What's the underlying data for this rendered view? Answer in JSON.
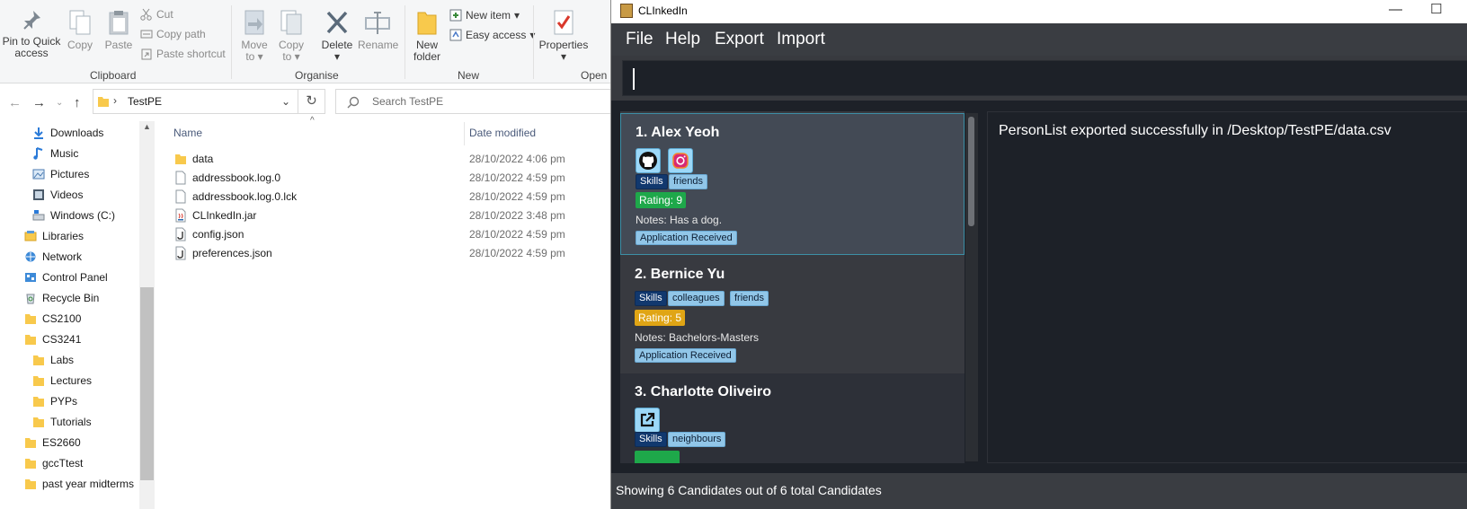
{
  "explorer": {
    "ribbon": {
      "clipboard": {
        "pin_label_1": "Pin to Quick",
        "pin_label_2": "access",
        "copy": "Copy",
        "paste": "Paste",
        "cut": "Cut",
        "copy_path": "Copy path",
        "paste_shortcut": "Paste shortcut",
        "group": "Clipboard"
      },
      "organise": {
        "move_to_1": "Move",
        "move_to_2": "to",
        "copy_to_1": "Copy",
        "copy_to_2": "to",
        "delete": "Delete",
        "rename": "Rename",
        "group": "Organise"
      },
      "new": {
        "new_folder_1": "New",
        "new_folder_2": "folder",
        "new_item": "New item",
        "easy_access": "Easy access",
        "group": "New"
      },
      "open": {
        "properties": "Properties",
        "group": "Open"
      }
    },
    "address": {
      "path": "TestPE",
      "search_placeholder": "Search TestPE"
    },
    "nav": {
      "items": [
        {
          "label": "Downloads",
          "icon": "download-icon"
        },
        {
          "label": "Music",
          "icon": "music-icon"
        },
        {
          "label": "Pictures",
          "icon": "pictures-icon"
        },
        {
          "label": "Videos",
          "icon": "videos-icon"
        },
        {
          "label": "Windows (C:)",
          "icon": "drive-icon"
        },
        {
          "label": "Libraries",
          "icon": "libraries-icon"
        },
        {
          "label": "Network",
          "icon": "network-icon"
        },
        {
          "label": "Control Panel",
          "icon": "control-panel-icon"
        },
        {
          "label": "Recycle Bin",
          "icon": "recycle-bin-icon"
        },
        {
          "label": "CS2100",
          "icon": "folder-icon"
        },
        {
          "label": "CS3241",
          "icon": "folder-icon"
        },
        {
          "label": "Labs",
          "icon": "folder-icon"
        },
        {
          "label": "Lectures",
          "icon": "folder-icon"
        },
        {
          "label": "PYPs",
          "icon": "folder-icon"
        },
        {
          "label": "Tutorials",
          "icon": "folder-icon"
        },
        {
          "label": "ES2660",
          "icon": "folder-icon"
        },
        {
          "label": "gccTtest",
          "icon": "folder-icon"
        },
        {
          "label": "past year midterms",
          "icon": "folder-icon"
        }
      ]
    },
    "files": {
      "col_name": "Name",
      "col_date": "Date modified",
      "rows": [
        {
          "name": "data",
          "date": "28/10/2022 4:06 pm",
          "icon": "folder-icon"
        },
        {
          "name": "addressbook.log.0",
          "date": "28/10/2022 4:59 pm",
          "icon": "file-icon"
        },
        {
          "name": "addressbook.log.0.lck",
          "date": "28/10/2022 4:59 pm",
          "icon": "file-icon"
        },
        {
          "name": "CLInkedIn.jar",
          "date": "28/10/2022 3:48 pm",
          "icon": "jar-icon"
        },
        {
          "name": "config.json",
          "date": "28/10/2022 4:59 pm",
          "icon": "json-icon"
        },
        {
          "name": "preferences.json",
          "date": "28/10/2022 4:59 pm",
          "icon": "json-icon"
        }
      ]
    }
  },
  "app": {
    "title": "CLInkedIn",
    "menu": [
      "File",
      "Help",
      "Export",
      "Import"
    ],
    "command": {
      "value": ""
    },
    "result": "PersonList exported successfully in /Desktop/TestPE/data.csv",
    "candidates": [
      {
        "index": "1.",
        "name": "Alex Yeoh",
        "links": [
          "github-icon",
          "instagram-icon"
        ],
        "tags": [
          {
            "label": "Skills",
            "kind": "skills"
          },
          {
            "label": "friends",
            "kind": "plain"
          }
        ],
        "rating": "Rating: 9",
        "rating_color": "#1ea84a",
        "notes": "Notes: Has a dog.",
        "status": "Application Received"
      },
      {
        "index": "2.",
        "name": "Bernice Yu",
        "links": [],
        "tags": [
          {
            "label": "Skills",
            "kind": "skills"
          },
          {
            "label": "colleagues",
            "kind": "plain"
          },
          {
            "label": "friends",
            "kind": "plain"
          }
        ],
        "rating": "Rating: 5",
        "rating_color": "#e0a515",
        "notes": "Notes: Bachelors-Masters",
        "status": "Application Received"
      },
      {
        "index": "3.",
        "name": "Charlotte Oliveiro",
        "links": [
          "external-link-icon"
        ],
        "tags": [
          {
            "label": "Skills",
            "kind": "skills"
          },
          {
            "label": "neighbours",
            "kind": "plain"
          }
        ],
        "rating": "",
        "rating_color": "#1ea84a",
        "notes": "",
        "status": ""
      }
    ],
    "status": {
      "prefix": "Showing",
      "shown": "6",
      "middle": "Candidates out of",
      "total": "6",
      "suffix": "total Candidates"
    }
  }
}
